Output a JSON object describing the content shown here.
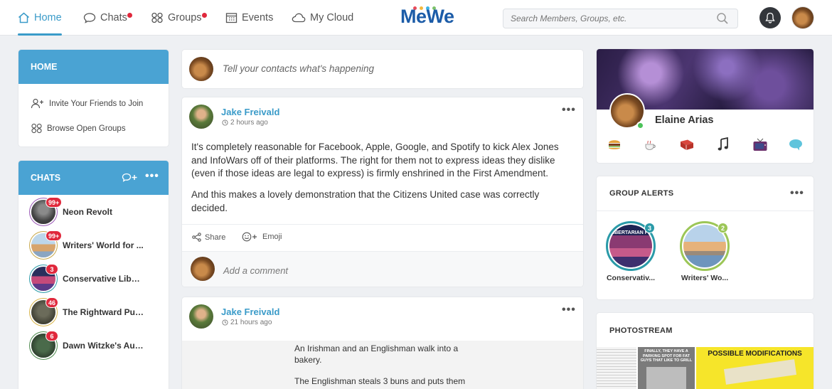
{
  "nav": {
    "home": "Home",
    "chats": "Chats",
    "groups": "Groups",
    "events": "Events",
    "cloud": "My Cloud",
    "logo": "MeWe",
    "search_placeholder": "Search Members, Groups, etc."
  },
  "colors": {
    "accent": "#3a9bc9",
    "header_blue": "#4aa3d3",
    "badge_red": "#e0283c",
    "logo_blue": "#1c5ca8"
  },
  "home_card": {
    "title": "HOME",
    "items": [
      {
        "label": "Invite Your Friends to Join",
        "icon": "add-person-icon"
      },
      {
        "label": "Browse Open Groups",
        "icon": "groups-icon"
      }
    ]
  },
  "chats_card": {
    "title": "CHATS",
    "items": [
      {
        "name": "Neon Revolt",
        "badge": "99+"
      },
      {
        "name": "Writers' World for ...",
        "badge": "99+"
      },
      {
        "name": "Conservative Liber...",
        "badge": "3"
      },
      {
        "name": "The Rightward Pus...",
        "badge": "46"
      },
      {
        "name": "Dawn Witzke's Aut...",
        "badge": "6"
      }
    ]
  },
  "composer": {
    "placeholder": "Tell your contacts what's happening"
  },
  "posts": [
    {
      "author": "Jake Freivald",
      "time": "2 hours ago",
      "paragraphs": [
        "It's completely reasonable for Facebook, Apple, Google, and Spotify to kick Alex Jones and InfoWars off of their platforms. The right for them not to express ideas they dislike (even if those ideas are legal to express) is firmly enshrined in the First Amendment.",
        "And this makes a lovely demonstration that the Citizens United case was correctly decided."
      ],
      "share_label": "Share",
      "emoji_label": "Emoji",
      "comment_placeholder": "Add a comment"
    },
    {
      "author": "Jake Freivald",
      "time": "21 hours ago",
      "image_lines": [
        "An Irishman and an Englishman walk into a",
        "bakery.",
        "The Englishman steals 3 buns and puts them"
      ]
    }
  ],
  "profile": {
    "name": "Elaine Arias",
    "interests": [
      "burger-icon",
      "coffee-icon",
      "book-icon",
      "music-note-icon",
      "tv-icon",
      "speech-bubble-icon"
    ]
  },
  "group_alerts": {
    "title": "GROUP ALERTS",
    "items": [
      {
        "name": "Conservativ...",
        "badge": "3",
        "ring": "#2a9aa8",
        "logo_text": "LIBERTARIAN FR"
      },
      {
        "name": "Writers' Wo...",
        "badge": "2",
        "ring": "#9cc657"
      }
    ]
  },
  "photostream": {
    "title": "PHOTOSTREAM",
    "thumb_texts": [
      "FINALLY, THEY HAVE A PARKING SPOT FOR FAT GUYS THAT LIKE TO GRILL",
      "POSSIBLE MODIFICATIONS"
    ]
  }
}
